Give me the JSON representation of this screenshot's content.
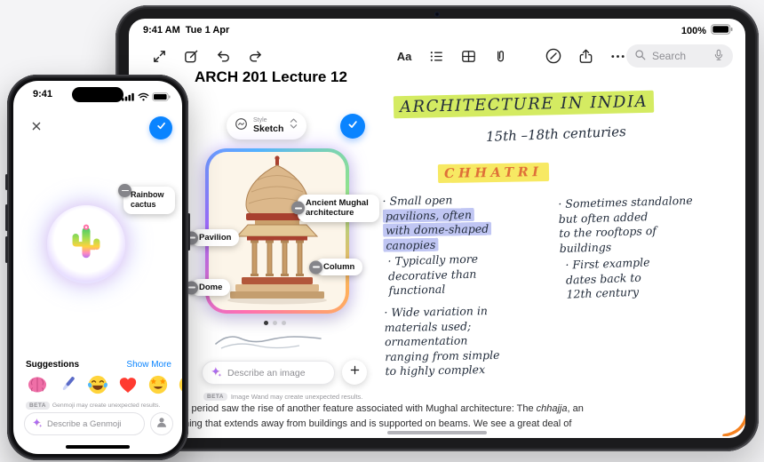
{
  "ipad": {
    "status": {
      "time": "9:41 AM",
      "date": "Tue 1 Apr",
      "battery": "100%"
    },
    "toolbar": {
      "format_label": "Aa",
      "search_placeholder": "Search"
    },
    "note": {
      "title": "ARCH 201 Lecture 12"
    },
    "image_wand": {
      "style_label": "Style",
      "style_value": "Sketch",
      "tags": [
        {
          "label": "Ancient Mughal architecture"
        },
        {
          "label": "Pavilion"
        },
        {
          "label": "Column"
        },
        {
          "label": "Dome"
        }
      ],
      "input_placeholder": "Describe an image",
      "beta_badge": "BETA",
      "beta_note": "Image Wand may create unexpected results."
    },
    "handwriting": {
      "heading": "ARCHITECTURE IN INDIA",
      "subheading": "15th –18th centuries",
      "topic": "CHHATRI",
      "bullet1_plain": "· Small open",
      "bullet1_highlight": "pavilions, often\nwith dome-shaped\ncanopies",
      "bullet2": "· Typically more\ndecorative than\nfunctional",
      "bullet3": "· Wide variation in\nmaterials used;\nornamentation\nranging from simple\nto highly complex",
      "bullet4": "· Sometimes standalone\nbut often added\nto the rooftops of\nbuildings",
      "bullet5": "· First example\ndates back to\n12th century"
    },
    "typed": {
      "line1_pre": "s period saw the rise of another feature associated with Mughal architecture: The ",
      "line1_italic": "chhajja",
      "line1_post": ", an",
      "line2": "ning that extends away from buildings and is supported on beams. We see a great deal of"
    }
  },
  "iphone": {
    "status": {
      "time": "9:41"
    },
    "genmoji": {
      "tag": "Rainbow cactus",
      "suggestions_label": "Suggestions",
      "show_more": "Show More",
      "beta_badge": "BETA",
      "beta_note": "Genmoji may create unexpected results.",
      "input_placeholder": "Describe a Genmoji"
    }
  }
}
